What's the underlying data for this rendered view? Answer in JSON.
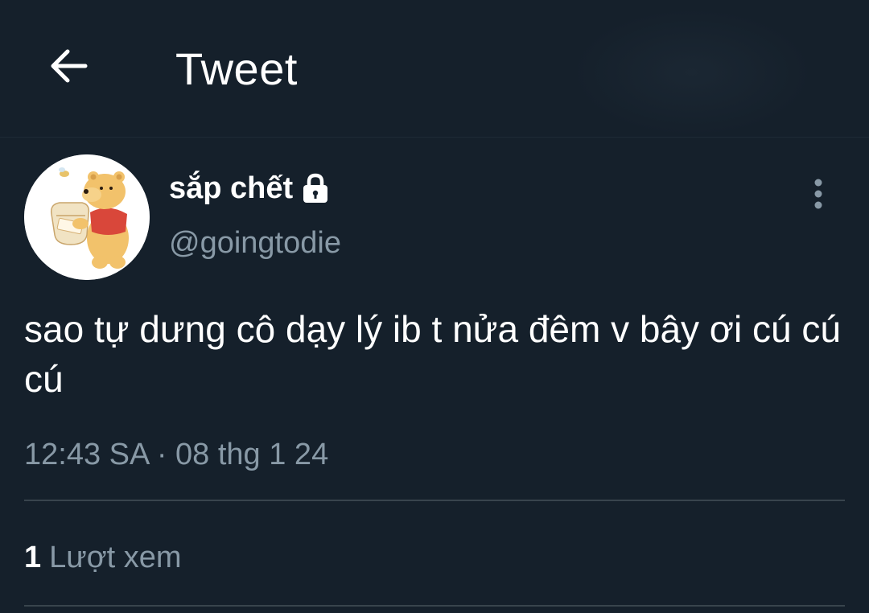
{
  "header": {
    "back_icon": "arrow-left-icon",
    "title": "Tweet"
  },
  "author": {
    "name": "sắp chết",
    "protected_icon": "lock-icon",
    "handle": "@goingtodie",
    "avatar_description_icon": "pooh-bear-avatar"
  },
  "more_icon": "vertical-dots-icon",
  "tweet": {
    "text": "sao tự dưng cô dạy lý ib t nửa đêm v bây ơi cú cú cú",
    "time": "12:43 SA",
    "separator": "·",
    "date": "08 thg 1 24"
  },
  "stats": {
    "views_count": "1",
    "views_label": "Lượt xem"
  },
  "colors": {
    "background": "#15202b",
    "secondary_text": "#8899a6",
    "divider": "#38444d"
  }
}
